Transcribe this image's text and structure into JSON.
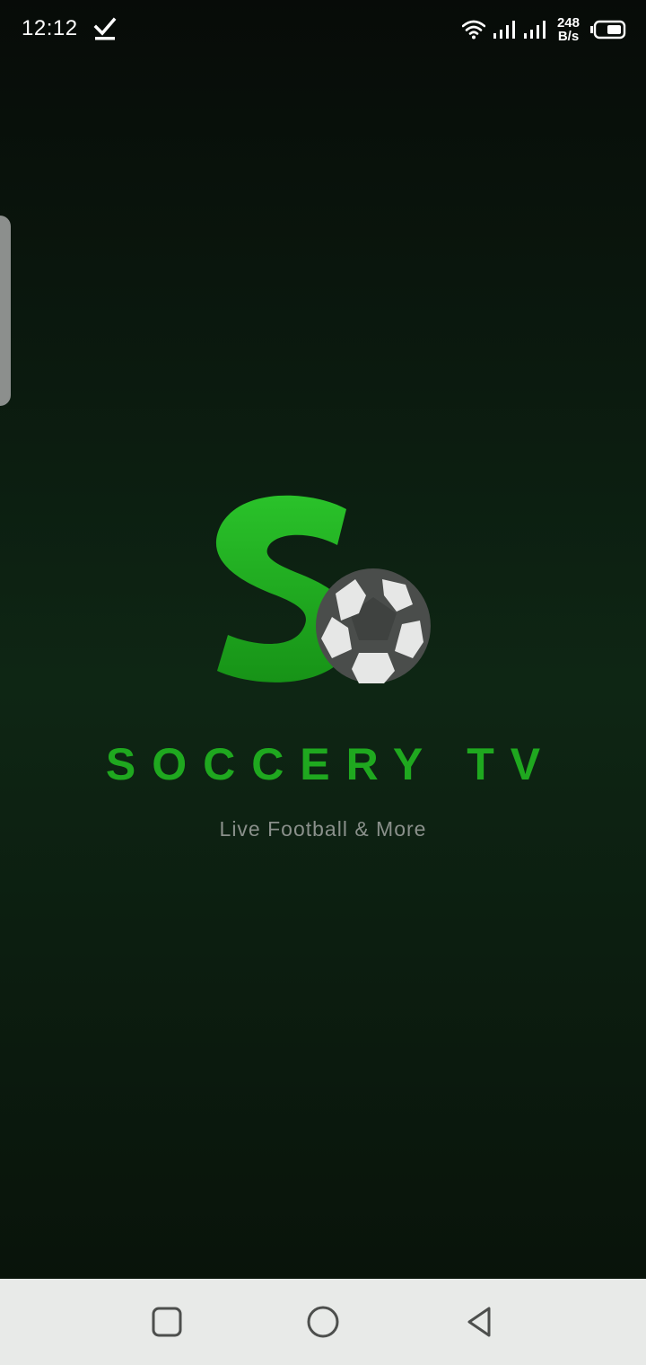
{
  "status_bar": {
    "time": "12:12",
    "net_speed_value": "248",
    "net_speed_unit": "B/s",
    "icons": [
      "download-check-icon",
      "wifi-icon",
      "signal-icon",
      "signal-icon",
      "battery-icon"
    ]
  },
  "splash": {
    "title": "SOCCERY TV",
    "tagline": "Live Football & More",
    "logo_icon": "soccer-ball-icon",
    "colors": {
      "accent_green": "#1fa81f",
      "background": "#0e2614"
    }
  },
  "nav_bar": {
    "buttons": [
      "recents-icon",
      "home-icon",
      "back-icon"
    ]
  }
}
